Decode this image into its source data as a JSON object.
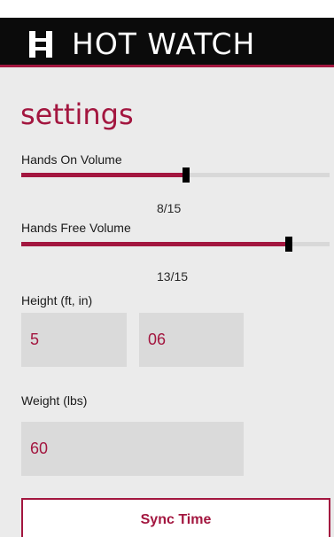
{
  "app": {
    "title": "HOT WATCH",
    "accent_color": "#a3163f",
    "logo_icon": "hot-watch-h-logo"
  },
  "page": {
    "title": "settings"
  },
  "hands_on_volume": {
    "label": "Hands On Volume",
    "value": 8,
    "max": 15,
    "display": "8/15"
  },
  "hands_free_volume": {
    "label": "Hands Free Volume",
    "value": 13,
    "max": 15,
    "display": "13/15"
  },
  "height": {
    "label": "Height (ft, in)",
    "feet": "5",
    "inches": "06"
  },
  "weight": {
    "label": "Weight (lbs)",
    "value": "60"
  },
  "actions": {
    "sync_time_label": "Sync Time"
  }
}
